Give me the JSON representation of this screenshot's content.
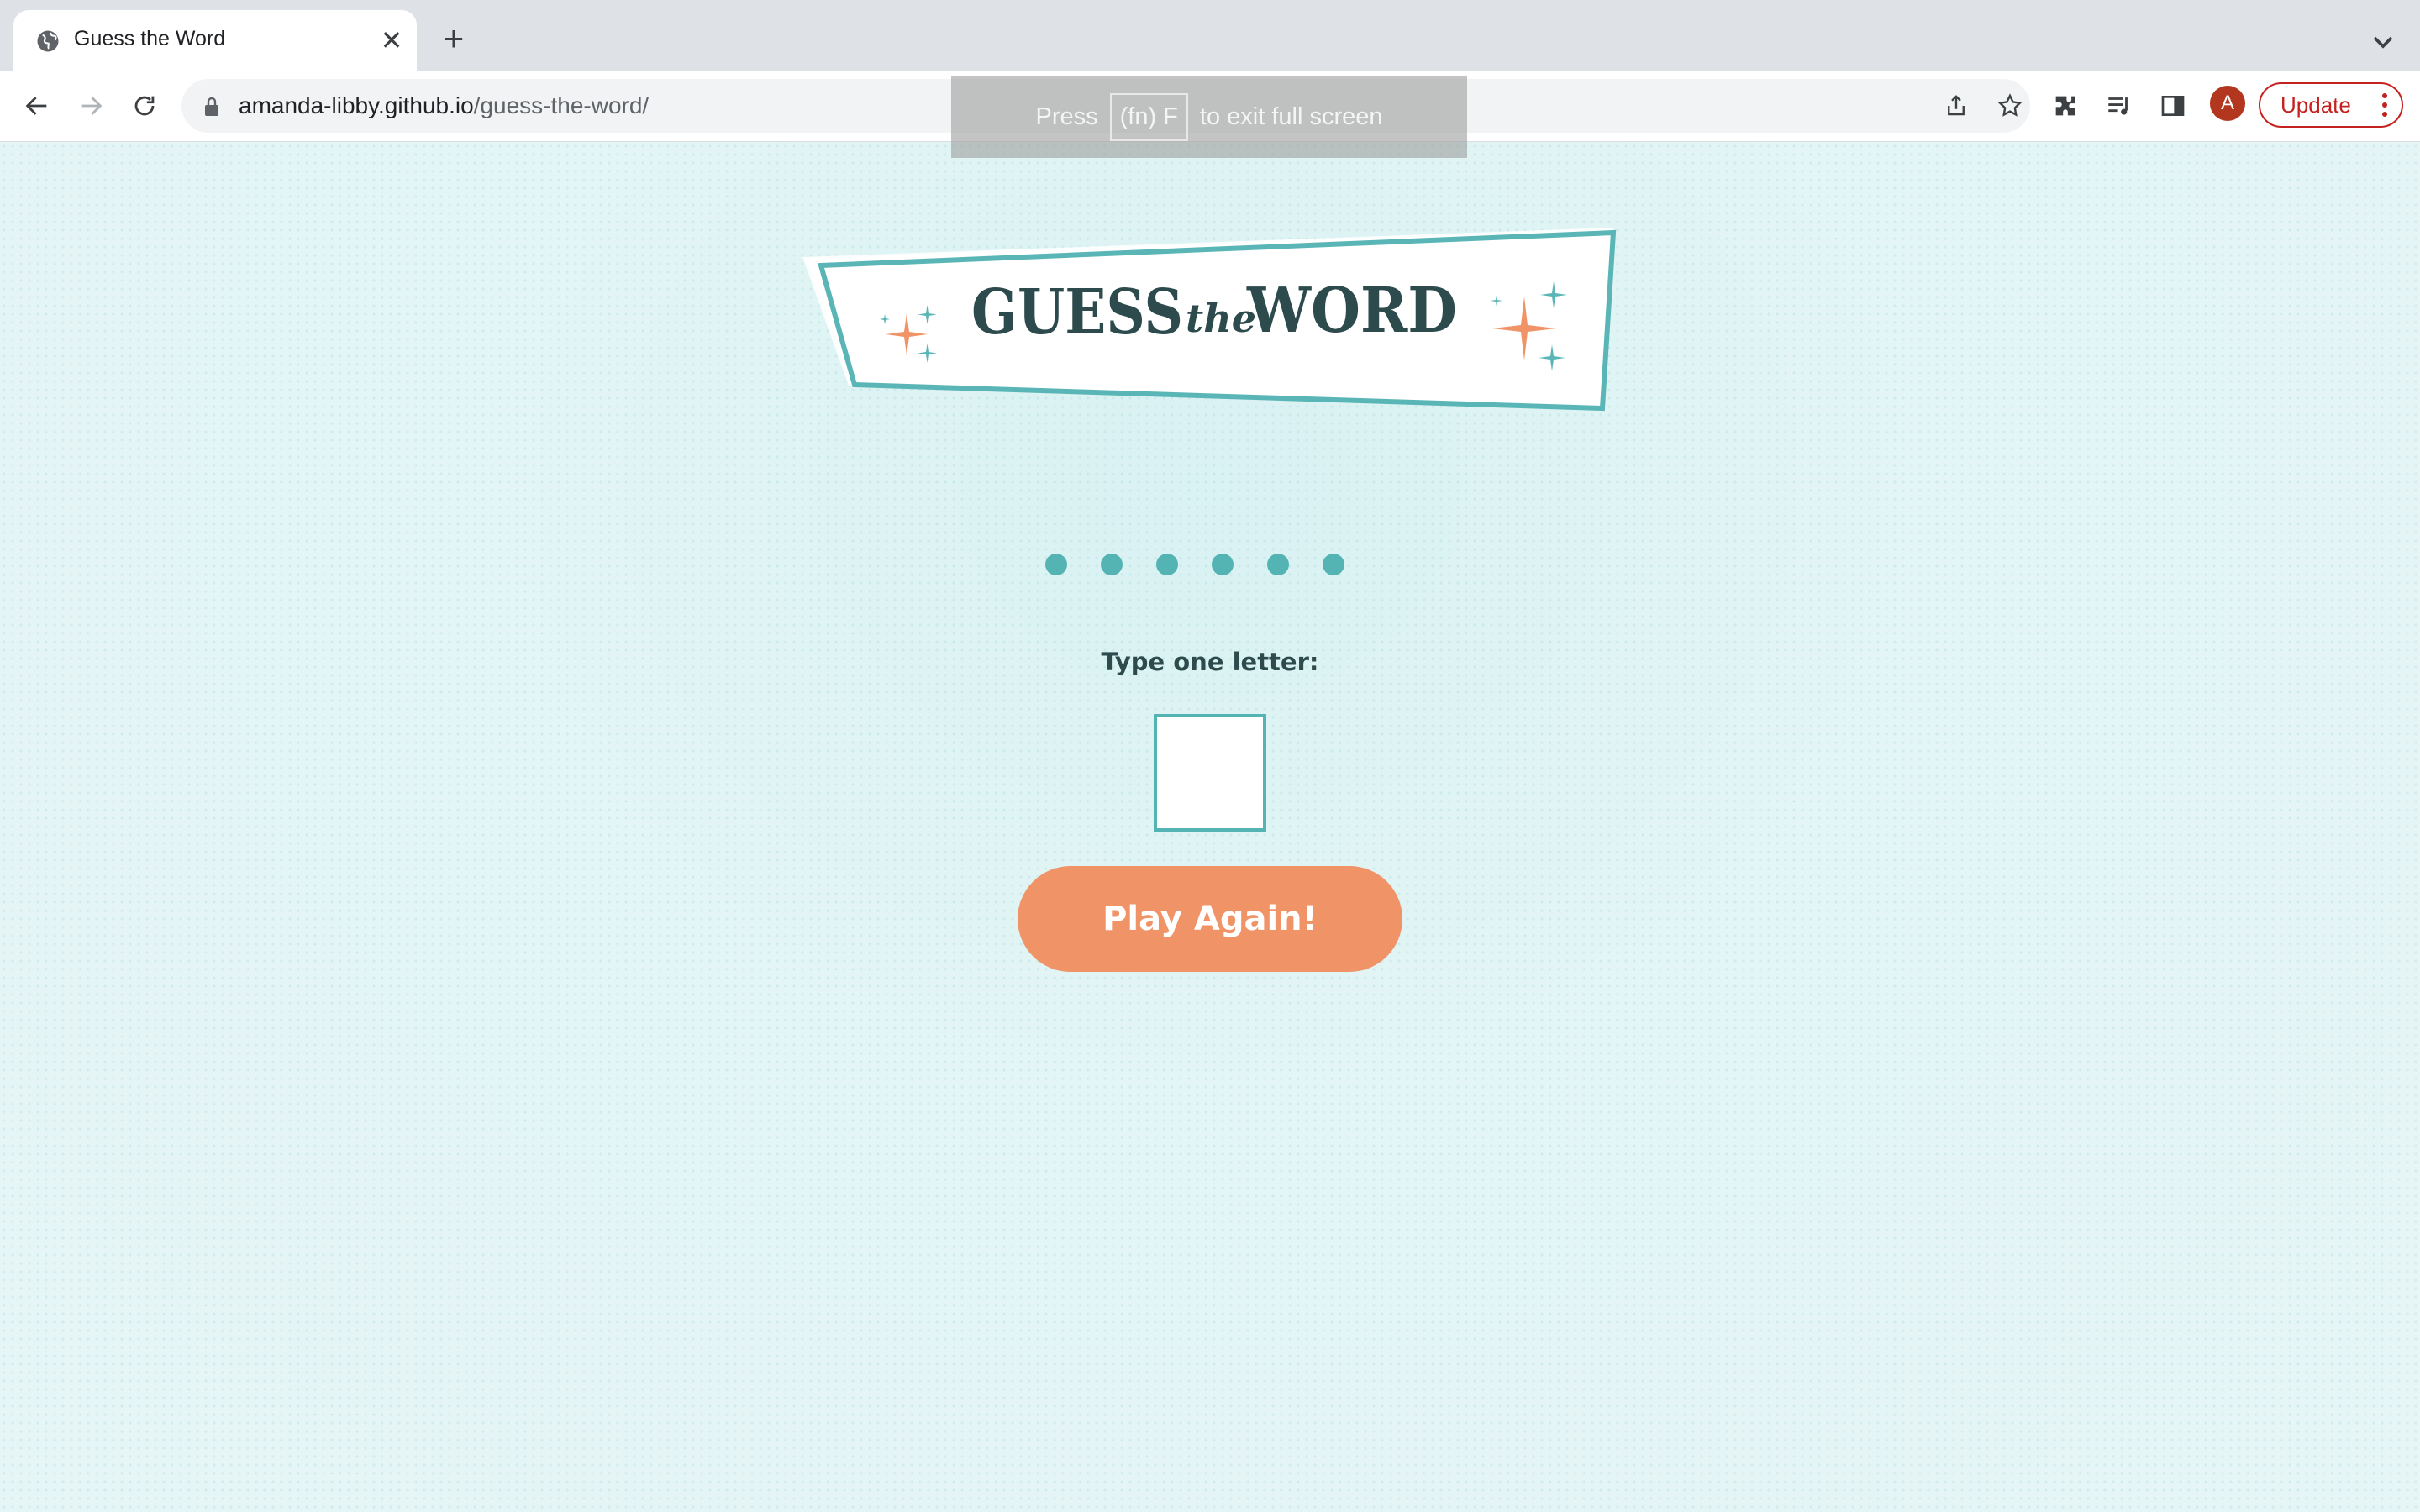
{
  "browser": {
    "tab": {
      "title": "Guess the Word",
      "close_glyph": "✕"
    },
    "new_tab_glyph": "+",
    "omnibox": {
      "host": "amanda-libby.github.io",
      "path": "/guess-the-word/"
    },
    "profile_initial": "A",
    "update_label": "Update",
    "fullscreen_toast": {
      "prefix": "Press",
      "key": "(fn) F",
      "suffix": "to exit full screen"
    }
  },
  "game": {
    "logo": {
      "word1": "GUESS",
      "the": "the",
      "word2": "WORD"
    },
    "word_placeholders": [
      "●",
      "●",
      "●",
      "●",
      "●",
      "●"
    ],
    "letter_label": "Type one letter:",
    "letter_value": "",
    "play_again_label": "Play Again!"
  },
  "colors": {
    "teal": "#54b3b3",
    "coral": "#f09367",
    "dark_slate": "#2d4a4d",
    "background": "#e6f5f5"
  }
}
